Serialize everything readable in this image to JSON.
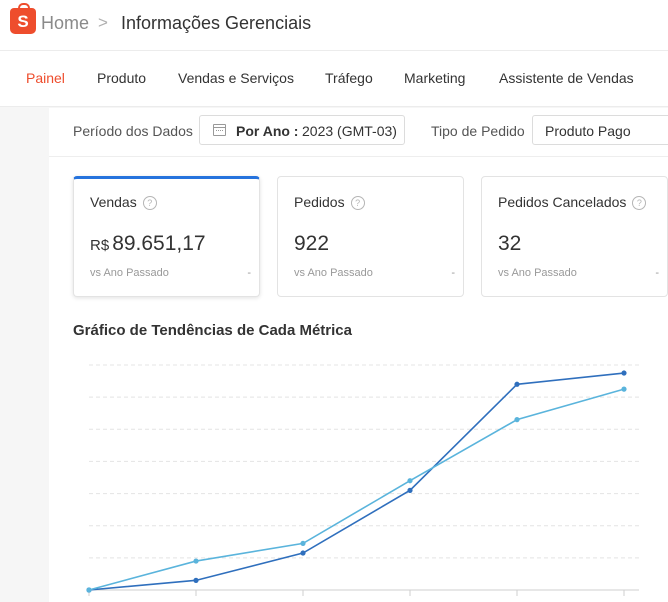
{
  "header": {
    "logo_letter": "S",
    "home": "Home",
    "separator": ">",
    "title": "Informações Gerenciais"
  },
  "tabs": [
    {
      "label": "Painel",
      "active": true
    },
    {
      "label": "Produto"
    },
    {
      "label": "Vendas e Serviços"
    },
    {
      "label": "Tráfego"
    },
    {
      "label": "Marketing"
    },
    {
      "label": "Assistente de Vendas"
    }
  ],
  "filters": {
    "period_label": "Período dos Dados",
    "period_strong": "Por Ano :",
    "period_value": "2023 (GMT-03)",
    "order_type_label": "Tipo de Pedido",
    "order_type_value": "Produto Pago"
  },
  "metrics": [
    {
      "title": "Vendas",
      "currency": "R$",
      "value": "89.651,17",
      "compare": "vs Ano Passado",
      "delta": "-",
      "selected": true
    },
    {
      "title": "Pedidos",
      "currency": "",
      "value": "922",
      "compare": "vs Ano Passado",
      "delta": "-"
    },
    {
      "title": "Pedidos Cancelados",
      "currency": "",
      "value": "32",
      "compare": "vs Ano Passado",
      "delta": "-"
    }
  ],
  "chart": {
    "title": "Gráfico de Tendências de Cada Métrica"
  },
  "chart_data": {
    "type": "line",
    "x": [
      1,
      2,
      3,
      4,
      5,
      6
    ],
    "ylim": [
      0,
      7
    ],
    "grid": true,
    "series": [
      {
        "color": "#2f6fbd",
        "values": [
          0.0,
          0.3,
          1.15,
          3.1,
          6.4,
          6.75
        ]
      },
      {
        "color": "#5ab4dc",
        "values": [
          0.0,
          0.9,
          1.45,
          3.4,
          5.3,
          6.25
        ]
      }
    ]
  },
  "colors": {
    "accent": "#ee4d2d",
    "selected_card": "#2673dd"
  }
}
